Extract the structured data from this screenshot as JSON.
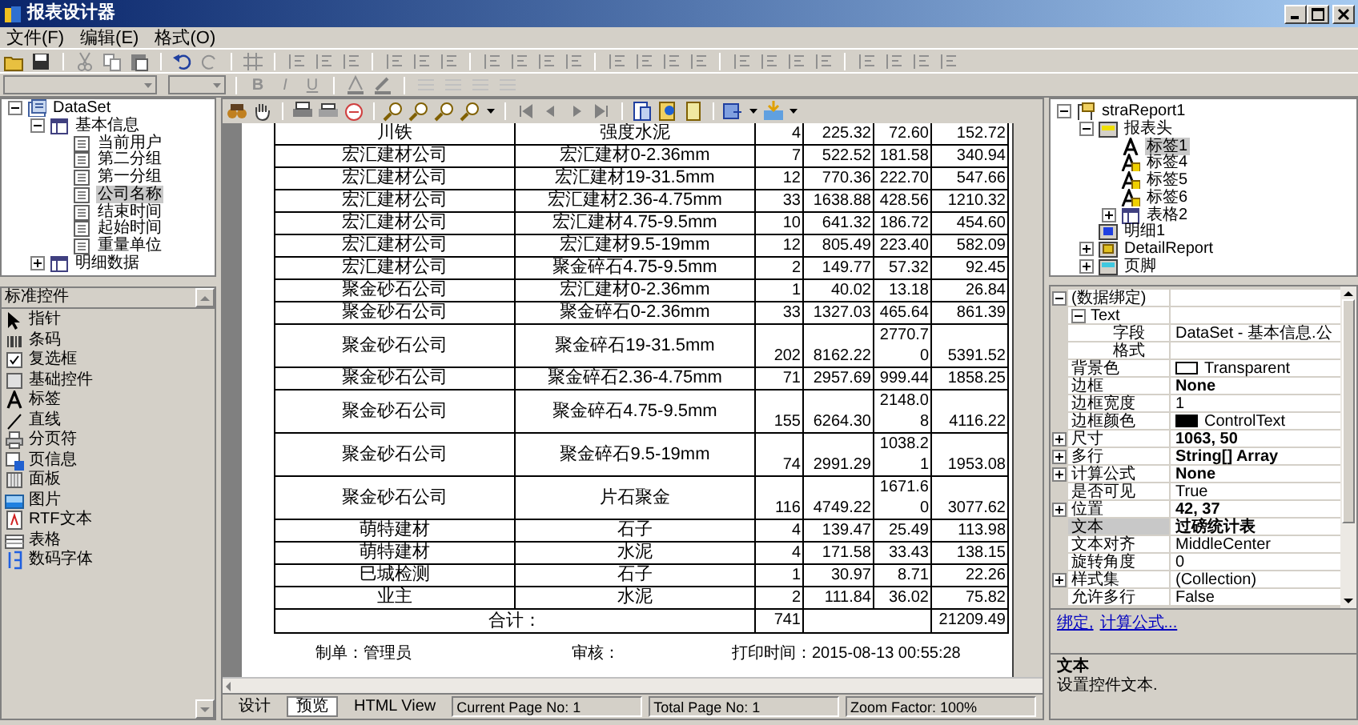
{
  "window": {
    "title": "报表设计器"
  },
  "menu": [
    {
      "label": "文件(F)"
    },
    {
      "label": "编辑(E)"
    },
    {
      "label": "格式(O)"
    }
  ],
  "format_buttons": [
    {
      "label": "B",
      "kind": "bold"
    },
    {
      "label": "I",
      "kind": "italic"
    },
    {
      "label": "U",
      "kind": "underline"
    }
  ],
  "data_tree": [
    {
      "label": "DataSet",
      "kind": "dataset",
      "expanded": true,
      "selected": false,
      "children": [
        {
          "label": "基本信息",
          "kind": "table",
          "expanded": true,
          "selected": false,
          "children": [
            {
              "label": "当前用户",
              "kind": "field",
              "selected": false
            },
            {
              "label": "第二分组",
              "kind": "field",
              "selected": false
            },
            {
              "label": "第一分组",
              "kind": "field",
              "selected": false
            },
            {
              "label": "公司名称",
              "kind": "field",
              "selected": true
            },
            {
              "label": "结束时间",
              "kind": "field",
              "selected": false
            },
            {
              "label": "起始时间",
              "kind": "field",
              "selected": false
            },
            {
              "label": "重量单位",
              "kind": "field",
              "selected": false
            }
          ]
        },
        {
          "label": "明细数据",
          "kind": "table",
          "expanded": false,
          "selected": false
        }
      ]
    }
  ],
  "toolbox": {
    "title": "标准控件",
    "items": [
      {
        "kind": "pointer",
        "label": "指针"
      },
      {
        "kind": "barcode",
        "label": "条码"
      },
      {
        "kind": "checkbox",
        "label": "复选框"
      },
      {
        "kind": "control",
        "label": "基础控件"
      },
      {
        "kind": "label",
        "label": "标签"
      },
      {
        "kind": "line",
        "label": "直线"
      },
      {
        "kind": "pagebreak",
        "label": "分页符"
      },
      {
        "kind": "pageinfo",
        "label": "页信息"
      },
      {
        "kind": "panel",
        "label": "面板"
      },
      {
        "kind": "picture",
        "label": "图片"
      },
      {
        "kind": "rtf",
        "label": "RTF文本"
      },
      {
        "kind": "table",
        "label": "表格"
      },
      {
        "kind": "digital",
        "label": "数码字体"
      }
    ]
  },
  "report": {
    "rows": [
      {
        "cells": [
          "川铁",
          "强度水泥",
          "4",
          "225.32",
          "72.60",
          "152.72"
        ]
      },
      {
        "cells": [
          "宏汇建材公司",
          "宏汇建材0-2.36mm",
          "7",
          "522.52",
          "181.58",
          "340.94"
        ]
      },
      {
        "cells": [
          "宏汇建材公司",
          "宏汇建材19-31.5mm",
          "12",
          "770.36",
          "222.70",
          "547.66"
        ]
      },
      {
        "cells": [
          "宏汇建材公司",
          "宏汇建材2.36-4.75mm",
          "33",
          "1638.88",
          "428.56",
          "1210.32"
        ]
      },
      {
        "cells": [
          "宏汇建材公司",
          "宏汇建材4.75-9.5mm",
          "10",
          "641.32",
          "186.72",
          "454.60"
        ]
      },
      {
        "cells": [
          "宏汇建材公司",
          "宏汇建材9.5-19mm",
          "12",
          "805.49",
          "223.40",
          "582.09"
        ]
      },
      {
        "cells": [
          "宏汇建材公司",
          "聚金碎石4.75-9.5mm",
          "2",
          "149.77",
          "57.32",
          "92.45"
        ]
      },
      {
        "cells": [
          "聚金砂石公司",
          "宏汇建材0-2.36mm",
          "1",
          "40.02",
          "13.18",
          "26.84"
        ]
      },
      {
        "cells": [
          "聚金砂石公司",
          "聚金碎石0-2.36mm",
          "33",
          "1327.03",
          "465.64",
          "861.39"
        ]
      },
      {
        "cells": [
          "聚金砂石公司",
          "聚金碎石19-31.5mm",
          "202",
          "8162.22",
          "2770.70",
          "5391.52"
        ]
      },
      {
        "cells": [
          "聚金砂石公司",
          "聚金碎石2.36-4.75mm",
          "71",
          "2957.69",
          "999.44",
          "1858.25"
        ]
      },
      {
        "cells": [
          "聚金砂石公司",
          "聚金碎石4.75-9.5mm",
          "155",
          "6264.30",
          "2148.08",
          "4116.22"
        ]
      },
      {
        "cells": [
          "聚金砂石公司",
          "聚金碎石9.5-19mm",
          "74",
          "2991.29",
          "1038.21",
          "1953.08"
        ]
      },
      {
        "cells": [
          "聚金砂石公司",
          "片石聚金",
          "116",
          "4749.22",
          "1671.60",
          "3077.62"
        ]
      },
      {
        "cells": [
          "萌特建材",
          "石子",
          "4",
          "139.47",
          "25.49",
          "113.98"
        ]
      },
      {
        "cells": [
          "萌特建材",
          "水泥",
          "4",
          "171.58",
          "33.43",
          "138.15"
        ]
      },
      {
        "cells": [
          "巳城检测",
          "石子",
          "1",
          "30.97",
          "8.71",
          "22.26"
        ]
      },
      {
        "cells": [
          "业主",
          "水泥",
          "2",
          "111.84",
          "36.02",
          "75.82"
        ]
      }
    ],
    "total": {
      "label": "合计：",
      "qty": "741",
      "amount": "21209.49"
    },
    "footer": [
      "制单：管理员",
      "审核：",
      "打印时间：2015-08-13 00:55:28"
    ]
  },
  "bottom_tabs": [
    {
      "label": "设计",
      "selected": false
    },
    {
      "label": "预览",
      "selected": true
    },
    {
      "label": "HTML View",
      "selected": false
    }
  ],
  "status_bar": [
    "Current Page No: 1",
    "Total Page No: 1",
    "Zoom Factor: 100%"
  ],
  "report_tree": [
    {
      "label": "straReport1",
      "kind": "report",
      "expanded": true,
      "selected": false,
      "children": [
        {
          "label": "报表头",
          "kind": "band-header",
          "expanded": true,
          "selected": false,
          "children": [
            {
              "label": "标签1",
              "kind": "label",
              "selected": true
            },
            {
              "label": "标签4",
              "kind": "label-locked",
              "selected": false
            },
            {
              "label": "标签5",
              "kind": "label-locked",
              "selected": false
            },
            {
              "label": "标签6",
              "kind": "label-locked",
              "selected": false
            },
            {
              "label": "表格2",
              "kind": "table",
              "expanded": false,
              "selected": false
            }
          ]
        },
        {
          "label": "明细1",
          "kind": "band-detail",
          "selected": false
        },
        {
          "label": "DetailReport",
          "kind": "detail-report",
          "expanded": false,
          "selected": false
        },
        {
          "label": "页脚",
          "kind": "band-footer",
          "expanded": false,
          "selected": false
        }
      ]
    }
  ],
  "properties": [
    {
      "name": "(数据绑定)",
      "expanded": true,
      "selected": false,
      "children": [
        {
          "name": "Text",
          "expanded": true,
          "selected": false,
          "children": [
            {
              "name": "字段",
              "value": "DataSet - 基本信息.公",
              "selected": false,
              "modified": false
            },
            {
              "name": "格式",
              "selected": false
            }
          ]
        }
      ]
    },
    {
      "name": "背景色",
      "value": "Transparent",
      "color": "#ffffff",
      "selected": false,
      "modified": false
    },
    {
      "name": "边框",
      "value": "None",
      "selected": false,
      "modified": true
    },
    {
      "name": "边框宽度",
      "value": "1",
      "selected": false,
      "modified": false
    },
    {
      "name": "边框颜色",
      "value": "ControlText",
      "color": "#000000",
      "selected": false,
      "modified": false
    },
    {
      "name": "尺寸",
      "value": "1063, 50",
      "expanded": false,
      "selected": false,
      "modified": true
    },
    {
      "name": "多行",
      "value": "String[] Array",
      "expanded": false,
      "selected": false,
      "modified": true
    },
    {
      "name": "计算公式",
      "value": "None",
      "expanded": false,
      "selected": false,
      "modified": true
    },
    {
      "name": "是否可见",
      "value": "True",
      "selected": false,
      "modified": false
    },
    {
      "name": "位置",
      "value": "42, 37",
      "expanded": false,
      "selected": false,
      "modified": true
    },
    {
      "name": "文本",
      "value": "过磅统计表",
      "selected": true,
      "modified": true
    },
    {
      "name": "文本对齐",
      "value": "MiddleCenter",
      "selected": false,
      "modified": false
    },
    {
      "name": "旋转角度",
      "value": "0",
      "selected": false,
      "modified": false
    },
    {
      "name": "样式集",
      "value": "(Collection)",
      "expanded": false,
      "selected": false,
      "modified": false
    },
    {
      "name": "允许多行",
      "value": "False",
      "selected": false,
      "modified": false
    }
  ],
  "property_links": [
    {
      "label": "绑定,"
    },
    {
      "label": "计算公式..."
    }
  ],
  "description": {
    "title": "文本",
    "text": "设置控件文本."
  }
}
